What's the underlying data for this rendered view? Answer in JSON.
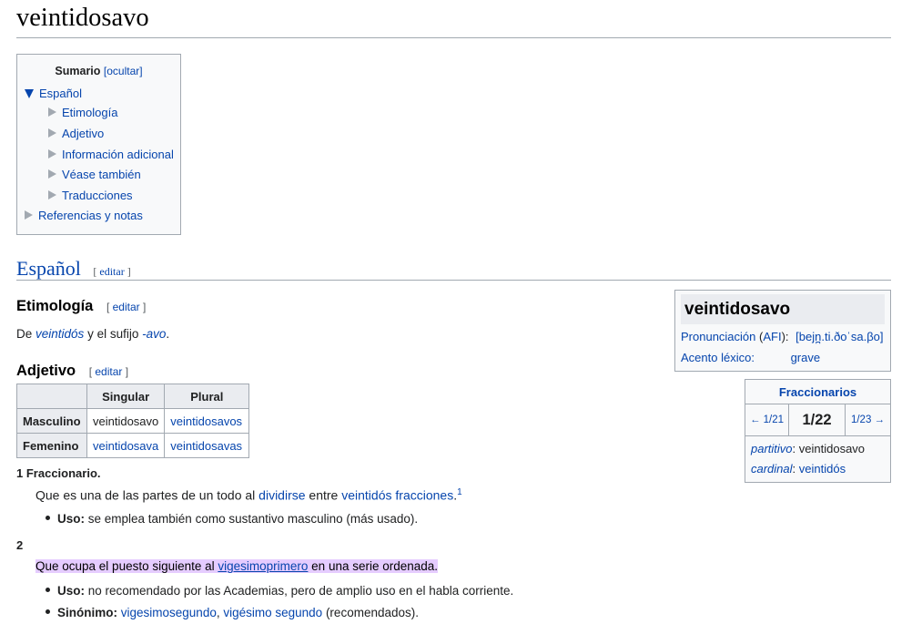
{
  "title": "veintidosavo",
  "toc": {
    "title": "Sumario",
    "hide": "[ocultar]",
    "items": [
      {
        "label": "Español"
      },
      {
        "label": "Etimología"
      },
      {
        "label": "Adjetivo"
      },
      {
        "label": "Información adicional"
      },
      {
        "label": "Véase también"
      },
      {
        "label": "Traducciones"
      },
      {
        "label": "Referencias y notas"
      }
    ]
  },
  "edit": {
    "open": "[",
    "label": "editar",
    "close": "]"
  },
  "sections": {
    "espanol": "Español",
    "etimologia": "Etimología",
    "adjetivo": "Adjetivo"
  },
  "etym": {
    "pre": "De ",
    "link1": "veintidós",
    "mid": " y el sufijo ",
    "link2": "-avo",
    "post": "."
  },
  "table": {
    "headers": [
      "",
      "Singular",
      "Plural"
    ],
    "rows": [
      {
        "label": "Masculino",
        "singular": "veintidosavo",
        "plural": "veintidosavos"
      },
      {
        "label": "Femenino",
        "singular": "veintidosava",
        "plural": "veintidosavas"
      }
    ]
  },
  "senses": {
    "s1_num": "1",
    "s1_label": "Fraccionario.",
    "s1_def_pre": "Que es una de las partes de un todo al ",
    "s1_def_link1": "dividirse",
    "s1_def_mid": " entre ",
    "s1_def_link2": "veintidós",
    "s1_def_sp": " ",
    "s1_def_link3": "fracciones",
    "s1_def_post": ".",
    "s1_sup": "1",
    "s1_uso_label": "Uso:",
    "s1_uso_text": " se emplea también como sustantivo masculino (más usado).",
    "s2_num": "2",
    "s2_def_pre": "Que ocupa el puesto siguiente al ",
    "s2_def_link": "vigesimoprimero",
    "s2_def_post": " en una serie ordenada.",
    "s2_uso_label": "Uso:",
    "s2_uso_text": " no recomendado por las Academias, pero de amplio uso en el habla corriente.",
    "s2_sin_label": "Sinónimo:",
    "s2_sin_link1": "vigesimosegundo",
    "s2_sin_comma": ", ",
    "s2_sin_link2": "vigésimo segundo",
    "s2_sin_post": " (recomendados)."
  },
  "infobox": {
    "title": "veintidosavo",
    "pron_label": "Pronunciación",
    "pron_afi_open": " (",
    "pron_afi": "AFI",
    "pron_afi_close": "):",
    "pron_value": "[bejn̪.ti.ðoˈsa.βo]",
    "acento_label": "Acento léxico:",
    "acento_value": "grave"
  },
  "fraccionarios": {
    "title": "Fraccionarios",
    "prev": "← 1/21",
    "current": "1/22",
    "next": "1/23 →",
    "partitivo_label": "partitivo",
    "partitivo_value": ": veintidosavo",
    "cardinal_label": "cardinal",
    "cardinal_sep": ": ",
    "cardinal_value": "veintidós"
  },
  "colors": {
    "link": "#0645ad",
    "highlight": "#e5ccff",
    "border": "#a2a9b1"
  }
}
